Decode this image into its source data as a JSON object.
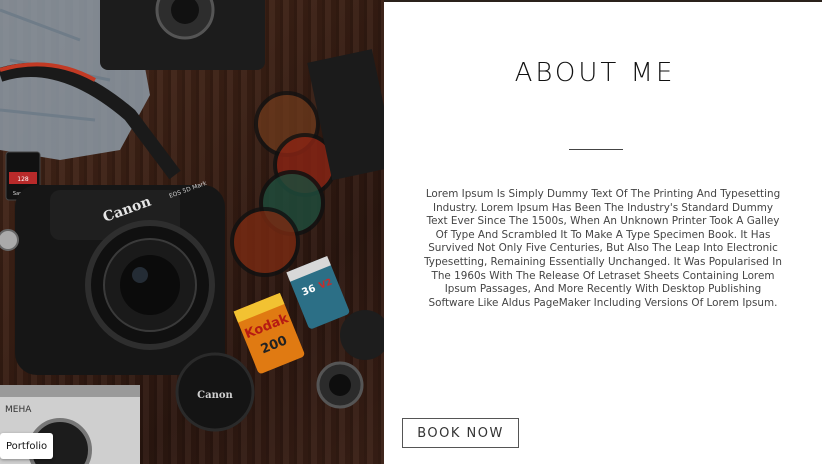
{
  "about": {
    "heading": "ABOUT ME",
    "body": "Lorem Ipsum Is Simply Dummy Text Of The Printing And Typesetting Industry. Lorem Ipsum Has Been The Industry's Standard Dummy Text Ever Since The 1500s, When An Unknown Printer Took A Galley Of Type And Scrambled It To Make A Type Specimen Book. It Has Survived Not Only Five Centuries, But Also The Leap Into Electronic Typesetting, Remaining Essentially Unchanged. It Was Popularised In The 1960s With The Release Of Letraset Sheets Containing Lorem Ipsum Passages, And More Recently With Desktop Publishing Software Like Aldus PageMaker Including Versions Of Lorem Ipsum.",
    "button_label": "BOOK NOW"
  },
  "badge": {
    "label": "Portfolio"
  },
  "photo_labels": {
    "camera_brand": "Canon",
    "camera_model": "EOS 5D Mark",
    "lens_cap_brand": "Canon",
    "film_brand": "Kodak",
    "film_speed": "200",
    "film2_count": "36",
    "film2_code": "V2",
    "sd_card": "SanDisk",
    "sd_capacity": "128",
    "old_camera_text": "MEHA"
  },
  "colors": {
    "wood_dark": "#2c1710",
    "wood_mid": "#4a2a1c",
    "film_orange": "#e07a12",
    "film_teal": "#2c6f86",
    "text_heading": "#111111",
    "text_body": "#444444"
  }
}
